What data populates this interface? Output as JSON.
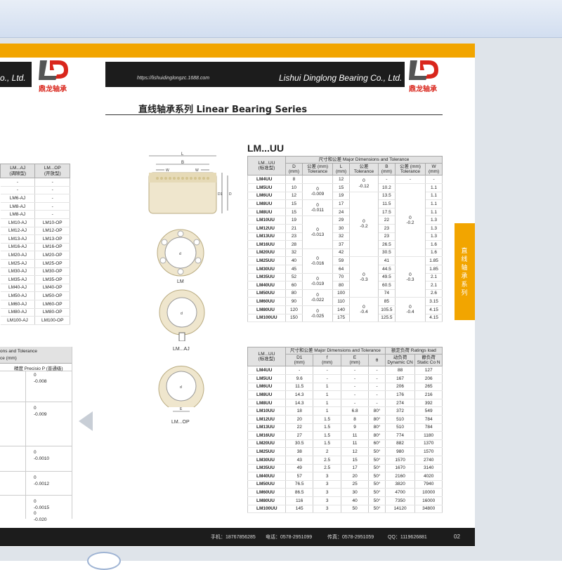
{
  "company": {
    "name_left": "o., Ltd.",
    "name_right": "Lishui Dinglong Bearing Co., Ltd.",
    "url": "https://lishuidinglongzc.1688.com",
    "logo_cn": "鼎龙轴承",
    "brand_color": "#d9261c",
    "accent_color": "#f2a500"
  },
  "section_title": "直线轴承系列 Linear Bearing Series",
  "side_tab": [
    "直",
    "线",
    "轴",
    "承",
    "系",
    "列"
  ],
  "model_title": "LM...UU",
  "diagram_labels": {
    "L": "L",
    "B": "B",
    "W": "W",
    "D1": "D1",
    "D": "D",
    "d": "d",
    "E": "E",
    "LM": "LM",
    "LMAJ": "LM...AJ",
    "LMOP": "LM...OP"
  },
  "left_table": {
    "headers": [
      "LM...AJ\n(调隙型)",
      "LM...OP\n(开放型)"
    ],
    "rows": [
      [
        "-",
        "-"
      ],
      [
        "-",
        "-"
      ],
      [
        "LM6-AJ",
        "-"
      ],
      [
        "LM8-AJ",
        "-"
      ],
      [
        "LM8-AJ",
        "-"
      ],
      [
        "LM10-AJ",
        "LM10-OP"
      ],
      [
        "LM12-AJ",
        "LM12-OP"
      ],
      [
        "LM13-AJ",
        "LM13-OP"
      ],
      [
        "LM16-AJ",
        "LM16-OP"
      ],
      [
        "LM20-AJ",
        "LM20-OP"
      ],
      [
        "LM25-AJ",
        "LM25-OP"
      ],
      [
        "LM30-AJ",
        "LM30-OP"
      ],
      [
        "LM35-AJ",
        "LM35-OP"
      ],
      [
        "LM40-AJ",
        "LM40-OP"
      ],
      [
        "LM50-AJ",
        "LM50-OP"
      ],
      [
        "LM60-AJ",
        "LM60-OP"
      ],
      [
        "LM80-AJ",
        "LM80-OP"
      ],
      [
        "LM100-AJ",
        "LM100-OP"
      ]
    ]
  },
  "left_tolerance": {
    "header1": "ons and Tolerance",
    "header2": "ce (mm)",
    "header3": "精度 Precisio  P (普通级)",
    "values": [
      [
        "0",
        "-0.008"
      ],
      [
        "0",
        "-0.009"
      ],
      [
        "0",
        "-0.0010"
      ],
      [
        "0",
        "-0.0012"
      ],
      [
        "0",
        "-0.0015"
      ],
      [
        "0",
        "-0.020"
      ]
    ]
  },
  "table1": {
    "group_header": "尺寸和公差 Major Dimensions and Tolerance",
    "col_model": "LM...UU\n(标准型)",
    "cols": [
      "D\n(mm)",
      "公差 (mm)\nTolerance",
      "L\n(mm)",
      "公差\nTolerance",
      "B\n(mm)",
      "公差 (mm)\nTolerance",
      "W\n(mm)"
    ],
    "rows": [
      [
        "LM4UU",
        "8",
        "12",
        "-",
        "-"
      ],
      [
        "LM5UU",
        "10",
        "15",
        "10.2",
        "1.1"
      ],
      [
        "LM6UU",
        "12",
        "19",
        "13.5",
        "1.1"
      ],
      [
        "LM8UU",
        "15",
        "17",
        "11.5",
        "1.1"
      ],
      [
        "LM8UU",
        "15",
        "24",
        "17.5",
        "1.1"
      ],
      [
        "LM10UU",
        "19",
        "29",
        "22",
        "1.3"
      ],
      [
        "LM12UU",
        "21",
        "30",
        "23",
        "1.3"
      ],
      [
        "LM13UU",
        "23",
        "32",
        "23",
        "1.3"
      ],
      [
        "LM16UU",
        "28",
        "37",
        "26.5",
        "1.6"
      ],
      [
        "LM20UU",
        "32",
        "42",
        "30.5",
        "1.6"
      ],
      [
        "LM25UU",
        "40",
        "59",
        "41",
        "1.85"
      ],
      [
        "LM30UU",
        "45",
        "64",
        "44.5",
        "1.85"
      ],
      [
        "LM35UU",
        "52",
        "70",
        "49.5",
        "2.1"
      ],
      [
        "LM40UU",
        "60",
        "80",
        "60.5",
        "2.1"
      ],
      [
        "LM50UU",
        "80",
        "100",
        "74",
        "2.6"
      ],
      [
        "LM60UU",
        "90",
        "110",
        "85",
        "3.15"
      ],
      [
        "LM80UU",
        "120",
        "140",
        "105.5",
        "4.15"
      ],
      [
        "LM100UU",
        "150",
        "175",
        "125.5",
        "4.15"
      ]
    ],
    "tolD": [
      {
        "text": "0\n-0.009"
      },
      {
        "text": "0\n-0.011"
      },
      {
        "text": "0\n-0.013"
      },
      {
        "text": "0\n-0.016"
      },
      {
        "text": "0\n-0.019"
      },
      {
        "text": "0\n-0.022"
      },
      {
        "text": "0\n-0.025"
      }
    ],
    "tolL": [
      {
        "text": "0\n-0.12"
      },
      {
        "text": "0\n-0.2"
      },
      {
        "text": "0\n-0.3"
      },
      {
        "text": "0\n-0.4"
      }
    ],
    "tolB": [
      {
        "text": "-"
      },
      {
        "text": "0\n-0.2"
      },
      {
        "text": "0\n-0.3"
      },
      {
        "text": "0\n-0.4"
      }
    ]
  },
  "table2": {
    "group_header1": "尺寸和公差 Major Dimensions and Tolerance",
    "group_header2": "额定负荷 Ratings load",
    "col_model": "LM...UU\n(标准型)",
    "cols": [
      "D1\n(mm)",
      "f\n(mm)",
      "E\n(mm)",
      "θ",
      "动负荷\nDynamic CN",
      "静负荷\nStatic Co N"
    ],
    "rows": [
      [
        "LM4UU",
        "-",
        "-",
        "-",
        "-",
        "88",
        "127"
      ],
      [
        "LM5UU",
        "9.6",
        "-",
        "-",
        "-",
        "167",
        "206"
      ],
      [
        "LM6UU",
        "11.5",
        "1",
        "-",
        "-",
        "206",
        "265"
      ],
      [
        "LM8UU",
        "14.3",
        "1",
        "-",
        "-",
        "176",
        "216"
      ],
      [
        "LM8UU",
        "14.3",
        "1",
        "-",
        "-",
        "274",
        "392"
      ],
      [
        "LM10UU",
        "18",
        "1",
        "6.8",
        "80°",
        "372",
        "549"
      ],
      [
        "LM12UU",
        "20",
        "1.5",
        "8",
        "80°",
        "510",
        "784"
      ],
      [
        "LM13UU",
        "22",
        "1.5",
        "9",
        "80°",
        "510",
        "784"
      ],
      [
        "LM16UU",
        "27",
        "1.5",
        "11",
        "80°",
        "774",
        "1180"
      ],
      [
        "LM20UU",
        "30.5",
        "1.5",
        "11",
        "60°",
        "882",
        "1370"
      ],
      [
        "LM25UU",
        "38",
        "2",
        "12",
        "50°",
        "980",
        "1570"
      ],
      [
        "LM30UU",
        "43",
        "2.5",
        "15",
        "50°",
        "1570",
        "2740"
      ],
      [
        "LM35UU",
        "49",
        "2.5",
        "17",
        "50°",
        "1670",
        "3140"
      ],
      [
        "LM40UU",
        "57",
        "3",
        "20",
        "50°",
        "2160",
        "4020"
      ],
      [
        "LM50UU",
        "76.5",
        "3",
        "25",
        "50°",
        "3820",
        "7940"
      ],
      [
        "LM60UU",
        "86.5",
        "3",
        "30",
        "50°",
        "4700",
        "10000"
      ],
      [
        "LM80UU",
        "116",
        "3",
        "40",
        "50°",
        "7350",
        "16000"
      ],
      [
        "LM100UU",
        "145",
        "3",
        "50",
        "50°",
        "14120",
        "34800"
      ]
    ]
  },
  "footer": {
    "mobile": "手机：18767856285",
    "tel": "电话：0578-2951099",
    "fax": "传真：0578-2951059",
    "qq": "QQ：1119626881",
    "page": "02"
  }
}
